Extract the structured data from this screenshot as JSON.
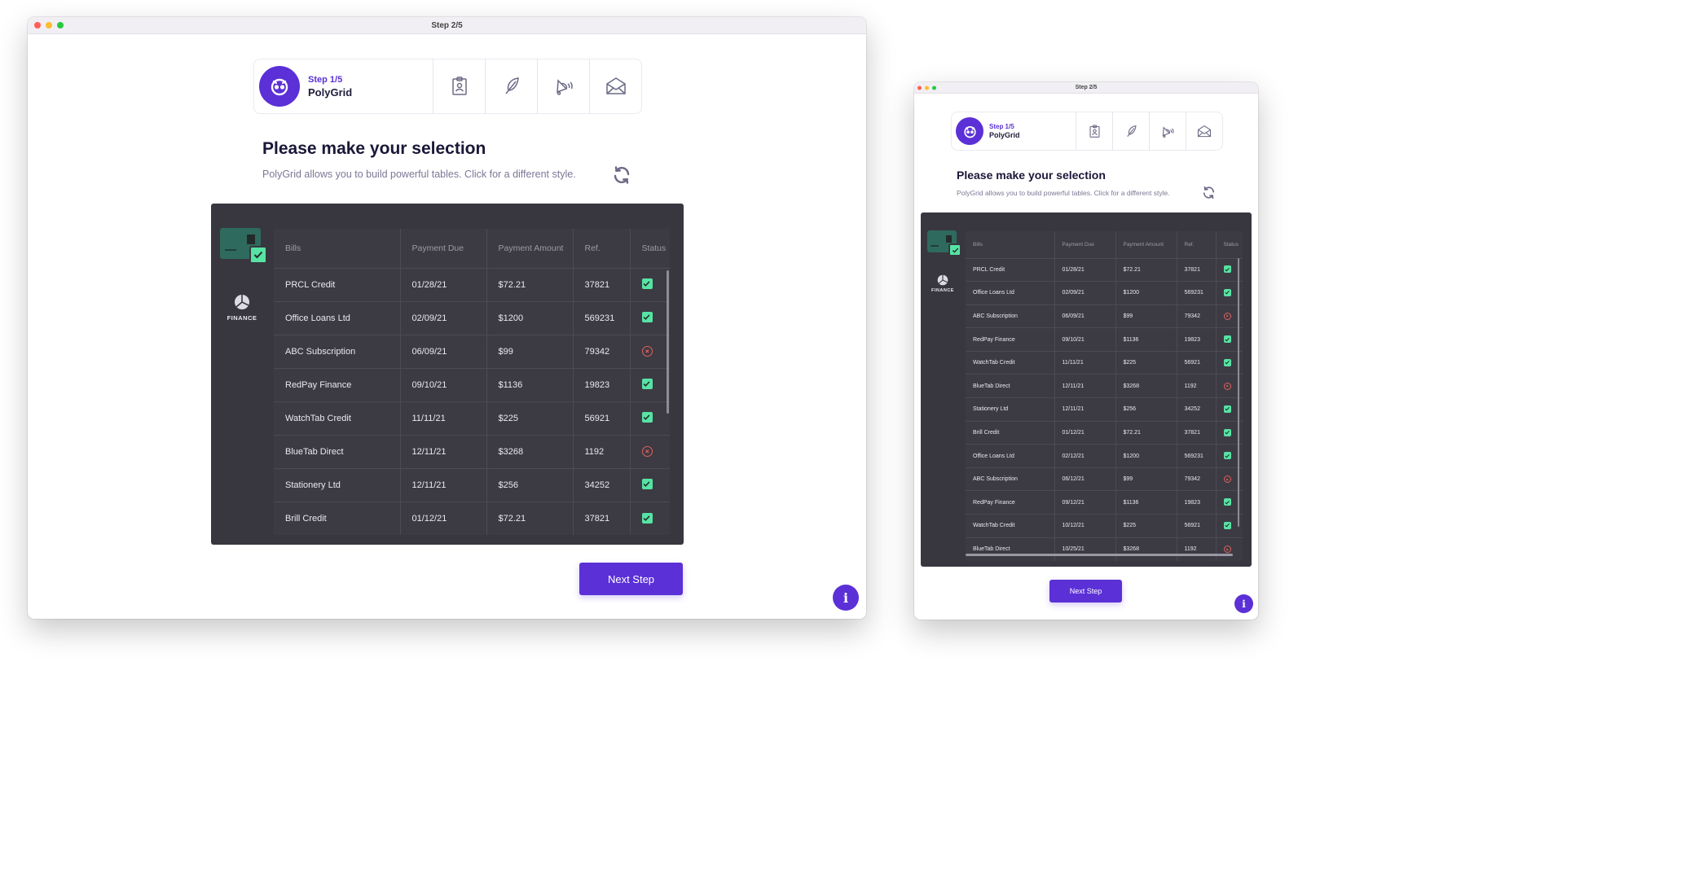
{
  "window_title": "Step 2/5",
  "stepper": {
    "step_label": "Step 1/5",
    "step_name": "PolyGrid",
    "icons": [
      "id-badge-icon",
      "feather-icon",
      "bell-icon",
      "envelope-icon"
    ]
  },
  "heading": "Please make your selection",
  "subtext": "PolyGrid allows you to build powerful tables. Click for a different style.",
  "sidebar": {
    "finance_label": "FINANCE"
  },
  "table": {
    "columns": [
      "Bills",
      "Payment Due",
      "Payment Amount",
      "Ref.",
      "Status"
    ],
    "rows_large": [
      {
        "bill": "PRCL Credit",
        "due": "01/28/21",
        "amount": "$72.21",
        "ref": "37821",
        "status": "ok"
      },
      {
        "bill": "Office Loans Ltd",
        "due": "02/09/21",
        "amount": "$1200",
        "ref": "569231",
        "status": "ok"
      },
      {
        "bill": "ABC Subscription",
        "due": "06/09/21",
        "amount": "$99",
        "ref": "79342",
        "status": "error"
      },
      {
        "bill": "RedPay Finance",
        "due": "09/10/21",
        "amount": "$1136",
        "ref": "19823",
        "status": "ok"
      },
      {
        "bill": "WatchTab Credit",
        "due": "11/11/21",
        "amount": "$225",
        "ref": "56921",
        "status": "ok"
      },
      {
        "bill": "BlueTab Direct",
        "due": "12/11/21",
        "amount": "$3268",
        "ref": "1192",
        "status": "error"
      },
      {
        "bill": "Stationery Ltd",
        "due": "12/11/21",
        "amount": "$256",
        "ref": "34252",
        "status": "ok"
      },
      {
        "bill": "Brill Credit",
        "due": "01/12/21",
        "amount": "$72.21",
        "ref": "37821",
        "status": "ok"
      }
    ],
    "rows_small": [
      {
        "bill": "PRCL Credit",
        "due": "01/28/21",
        "amount": "$72.21",
        "ref": "37821",
        "status": "ok"
      },
      {
        "bill": "Office Loans Ltd",
        "due": "02/09/21",
        "amount": "$1200",
        "ref": "569231",
        "status": "ok"
      },
      {
        "bill": "ABC Subscription",
        "due": "06/09/21",
        "amount": "$99",
        "ref": "79342",
        "status": "error"
      },
      {
        "bill": "RedPay Finance",
        "due": "09/10/21",
        "amount": "$1136",
        "ref": "19823",
        "status": "ok"
      },
      {
        "bill": "WatchTab Credit",
        "due": "11/11/21",
        "amount": "$225",
        "ref": "56921",
        "status": "ok"
      },
      {
        "bill": "BlueTab Direct",
        "due": "12/11/21",
        "amount": "$3268",
        "ref": "1192",
        "status": "error"
      },
      {
        "bill": "Stationery Ltd",
        "due": "12/11/21",
        "amount": "$256",
        "ref": "34252",
        "status": "ok"
      },
      {
        "bill": "Brill Credit",
        "due": "01/12/21",
        "amount": "$72.21",
        "ref": "37821",
        "status": "ok"
      },
      {
        "bill": "Office Loans Ltd",
        "due": "02/12/21",
        "amount": "$1200",
        "ref": "569231",
        "status": "ok"
      },
      {
        "bill": "ABC Subscription",
        "due": "06/12/21",
        "amount": "$99",
        "ref": "79342",
        "status": "error"
      },
      {
        "bill": "RedPay Finance",
        "due": "09/12/21",
        "amount": "$1136",
        "ref": "19823",
        "status": "ok"
      },
      {
        "bill": "WatchTab Credit",
        "due": "10/12/21",
        "amount": "$225",
        "ref": "56921",
        "status": "ok"
      },
      {
        "bill": "BlueTab Direct",
        "due": "10/25/21",
        "amount": "$3268",
        "ref": "1192",
        "status": "error"
      }
    ]
  },
  "next_button": "Next Step",
  "info_icon": "i",
  "colors": {
    "accent": "#5b30d6",
    "panel": "#38373f",
    "ok": "#57e3a4",
    "error": "#e0605e"
  }
}
